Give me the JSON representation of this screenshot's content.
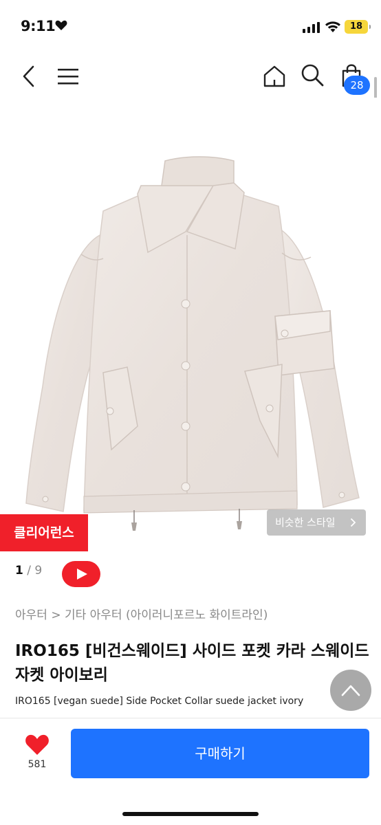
{
  "status_bar": {
    "time": "9:11",
    "battery": "18"
  },
  "nav": {
    "cart_count": "28"
  },
  "product": {
    "badge": "클리어런스",
    "similar_style": "비슷한 스타일",
    "pager_current": "1",
    "pager_sep_total": " / 9",
    "breadcrumb": "아우터 > 기타 아우터 (아이러니포르노 화이트라인)",
    "title": "IRO165 [비건스웨이드] 사이드 포켓 카라 스웨이드 자켓 아이보리",
    "subtitle": "IRO165 [vegan suede] Side Pocket Collar suede jacket ivory"
  },
  "bottom_bar": {
    "like_count": "581",
    "buy_label": "구매하기"
  },
  "colors": {
    "accent_blue": "#1e73ff",
    "clearance_red": "#f0202a",
    "jacket_ivory": "#ede6e1"
  },
  "icons": [
    "back-icon",
    "menu-icon",
    "home-icon",
    "search-icon",
    "cart-icon",
    "heart-icon",
    "youtube-play-icon",
    "chevron-up-icon",
    "chevron-right-icon"
  ]
}
